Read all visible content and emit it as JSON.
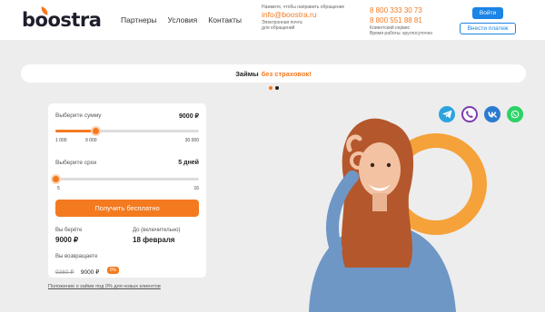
{
  "header": {
    "logo": "boostra",
    "nav": [
      "Партнеры",
      "Условия",
      "Контакты"
    ],
    "email_hint": "Нажмите, чтобы направить обращение",
    "email": "info@boostra.ru",
    "email_caption_1": "Электронная почта",
    "email_caption_2": "для обращений",
    "phone_1": "8 800 333 30 73",
    "phone_2": "8 800 551 88 81",
    "phone_caption_1": "Клиентский сервис",
    "phone_caption_2": "Время работы: круглосуточно",
    "login_label": "Войти",
    "pay_label": "Внести платеж"
  },
  "banner": {
    "text": "Займы",
    "accent": "без страховок!"
  },
  "calculator": {
    "amount_label": "Выберите сумму",
    "amount_value": "9000 ₽",
    "amount_ticks": [
      "1 000",
      "9 000",
      "30 000"
    ],
    "amount_fraction": 0.2759,
    "term_label": "Выберите срок",
    "term_value": "5 дней",
    "term_ticks": [
      "5",
      "16"
    ],
    "term_fraction": 0.0,
    "cta_label": "Получить бесплатно",
    "take_label": "Вы берёте",
    "take_value": "9000 ₽",
    "until_label": "До (включительно)",
    "until_value": "18 февраля",
    "return_label": "Вы возвращаете",
    "return_old": "9360 ₽",
    "return_new": "9000 ₽",
    "return_badge": "0%"
  },
  "footnote": "Положение о займе под 0% для новых клиентов",
  "socials": [
    "telegram-icon",
    "viber-icon",
    "vk-icon",
    "whatsapp-icon"
  ],
  "colors": {
    "accent": "#f47a20",
    "primary_blue": "#1b84e5"
  }
}
